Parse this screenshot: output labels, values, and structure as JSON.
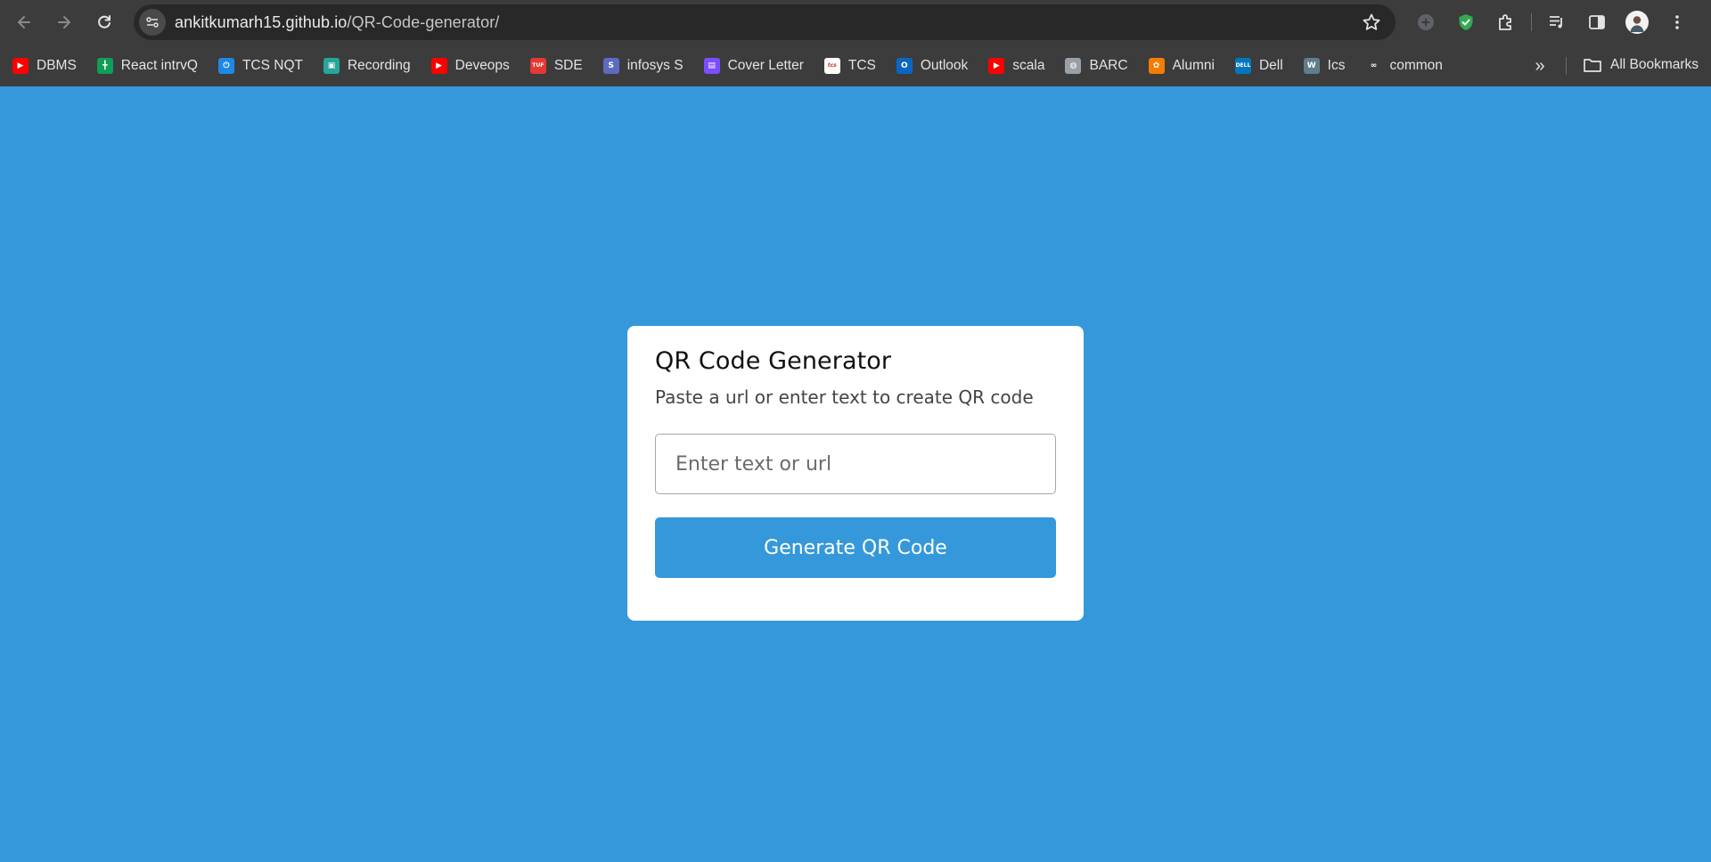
{
  "browser": {
    "url_host": "ankitkumarh15.github.io",
    "url_path": "/QR-Code-generator/"
  },
  "bookmarks": [
    {
      "label": "DBMS",
      "icon": "youtube-icon",
      "color": "#ff0000",
      "glyph": "▶"
    },
    {
      "label": "React intrvQ",
      "icon": "sheets-icon",
      "color": "#0f9d58",
      "glyph": "╋"
    },
    {
      "label": "TCS NQT",
      "icon": "power-icon",
      "color": "#1e88e5",
      "glyph": "⏻"
    },
    {
      "label": "Recording",
      "icon": "classroom-icon",
      "color": "#26a69a",
      "glyph": "▣"
    },
    {
      "label": "Deveops",
      "icon": "youtube-icon",
      "color": "#ff0000",
      "glyph": "▶"
    },
    {
      "label": "SDE",
      "icon": "tuf-icon",
      "color": "#e53935",
      "glyph": "TUF"
    },
    {
      "label": "infosys S",
      "icon": "springboard-icon",
      "color": "#5c6bc0",
      "glyph": "S"
    },
    {
      "label": "Cover Letter",
      "icon": "printer-icon",
      "color": "#7c4dff",
      "glyph": "▤"
    },
    {
      "label": "TCS",
      "icon": "tcs-icon",
      "color": "#ffffff",
      "glyph": "tcs"
    },
    {
      "label": "Outlook",
      "icon": "outlook-icon",
      "color": "#0a66c2",
      "glyph": "O"
    },
    {
      "label": "scala",
      "icon": "youtube-icon",
      "color": "#ff0000",
      "glyph": "▶"
    },
    {
      "label": "BARC",
      "icon": "globe-icon",
      "color": "#9aa0a6",
      "glyph": "◍"
    },
    {
      "label": "Alumni",
      "icon": "alumni-icon",
      "color": "#f57c00",
      "glyph": "✿"
    },
    {
      "label": "Dell",
      "icon": "dell-icon",
      "color": "#0277bd",
      "glyph": "DELL"
    },
    {
      "label": "Ics",
      "icon": "wc-icon",
      "color": "#607d8b",
      "glyph": "W"
    },
    {
      "label": "common",
      "icon": "infinity-icon",
      "color": "#3c3c3c",
      "glyph": "∞"
    }
  ],
  "all_bookmarks_label": "All Bookmarks",
  "card": {
    "title": "QR Code Generator",
    "subtitle": "Paste a url or enter text to create QR code",
    "input_placeholder": "Enter text or url",
    "button_label": "Generate QR Code"
  },
  "colors": {
    "page_bg": "#3598db",
    "chrome_bg": "#3c3c3c",
    "button_bg": "#3598db"
  }
}
